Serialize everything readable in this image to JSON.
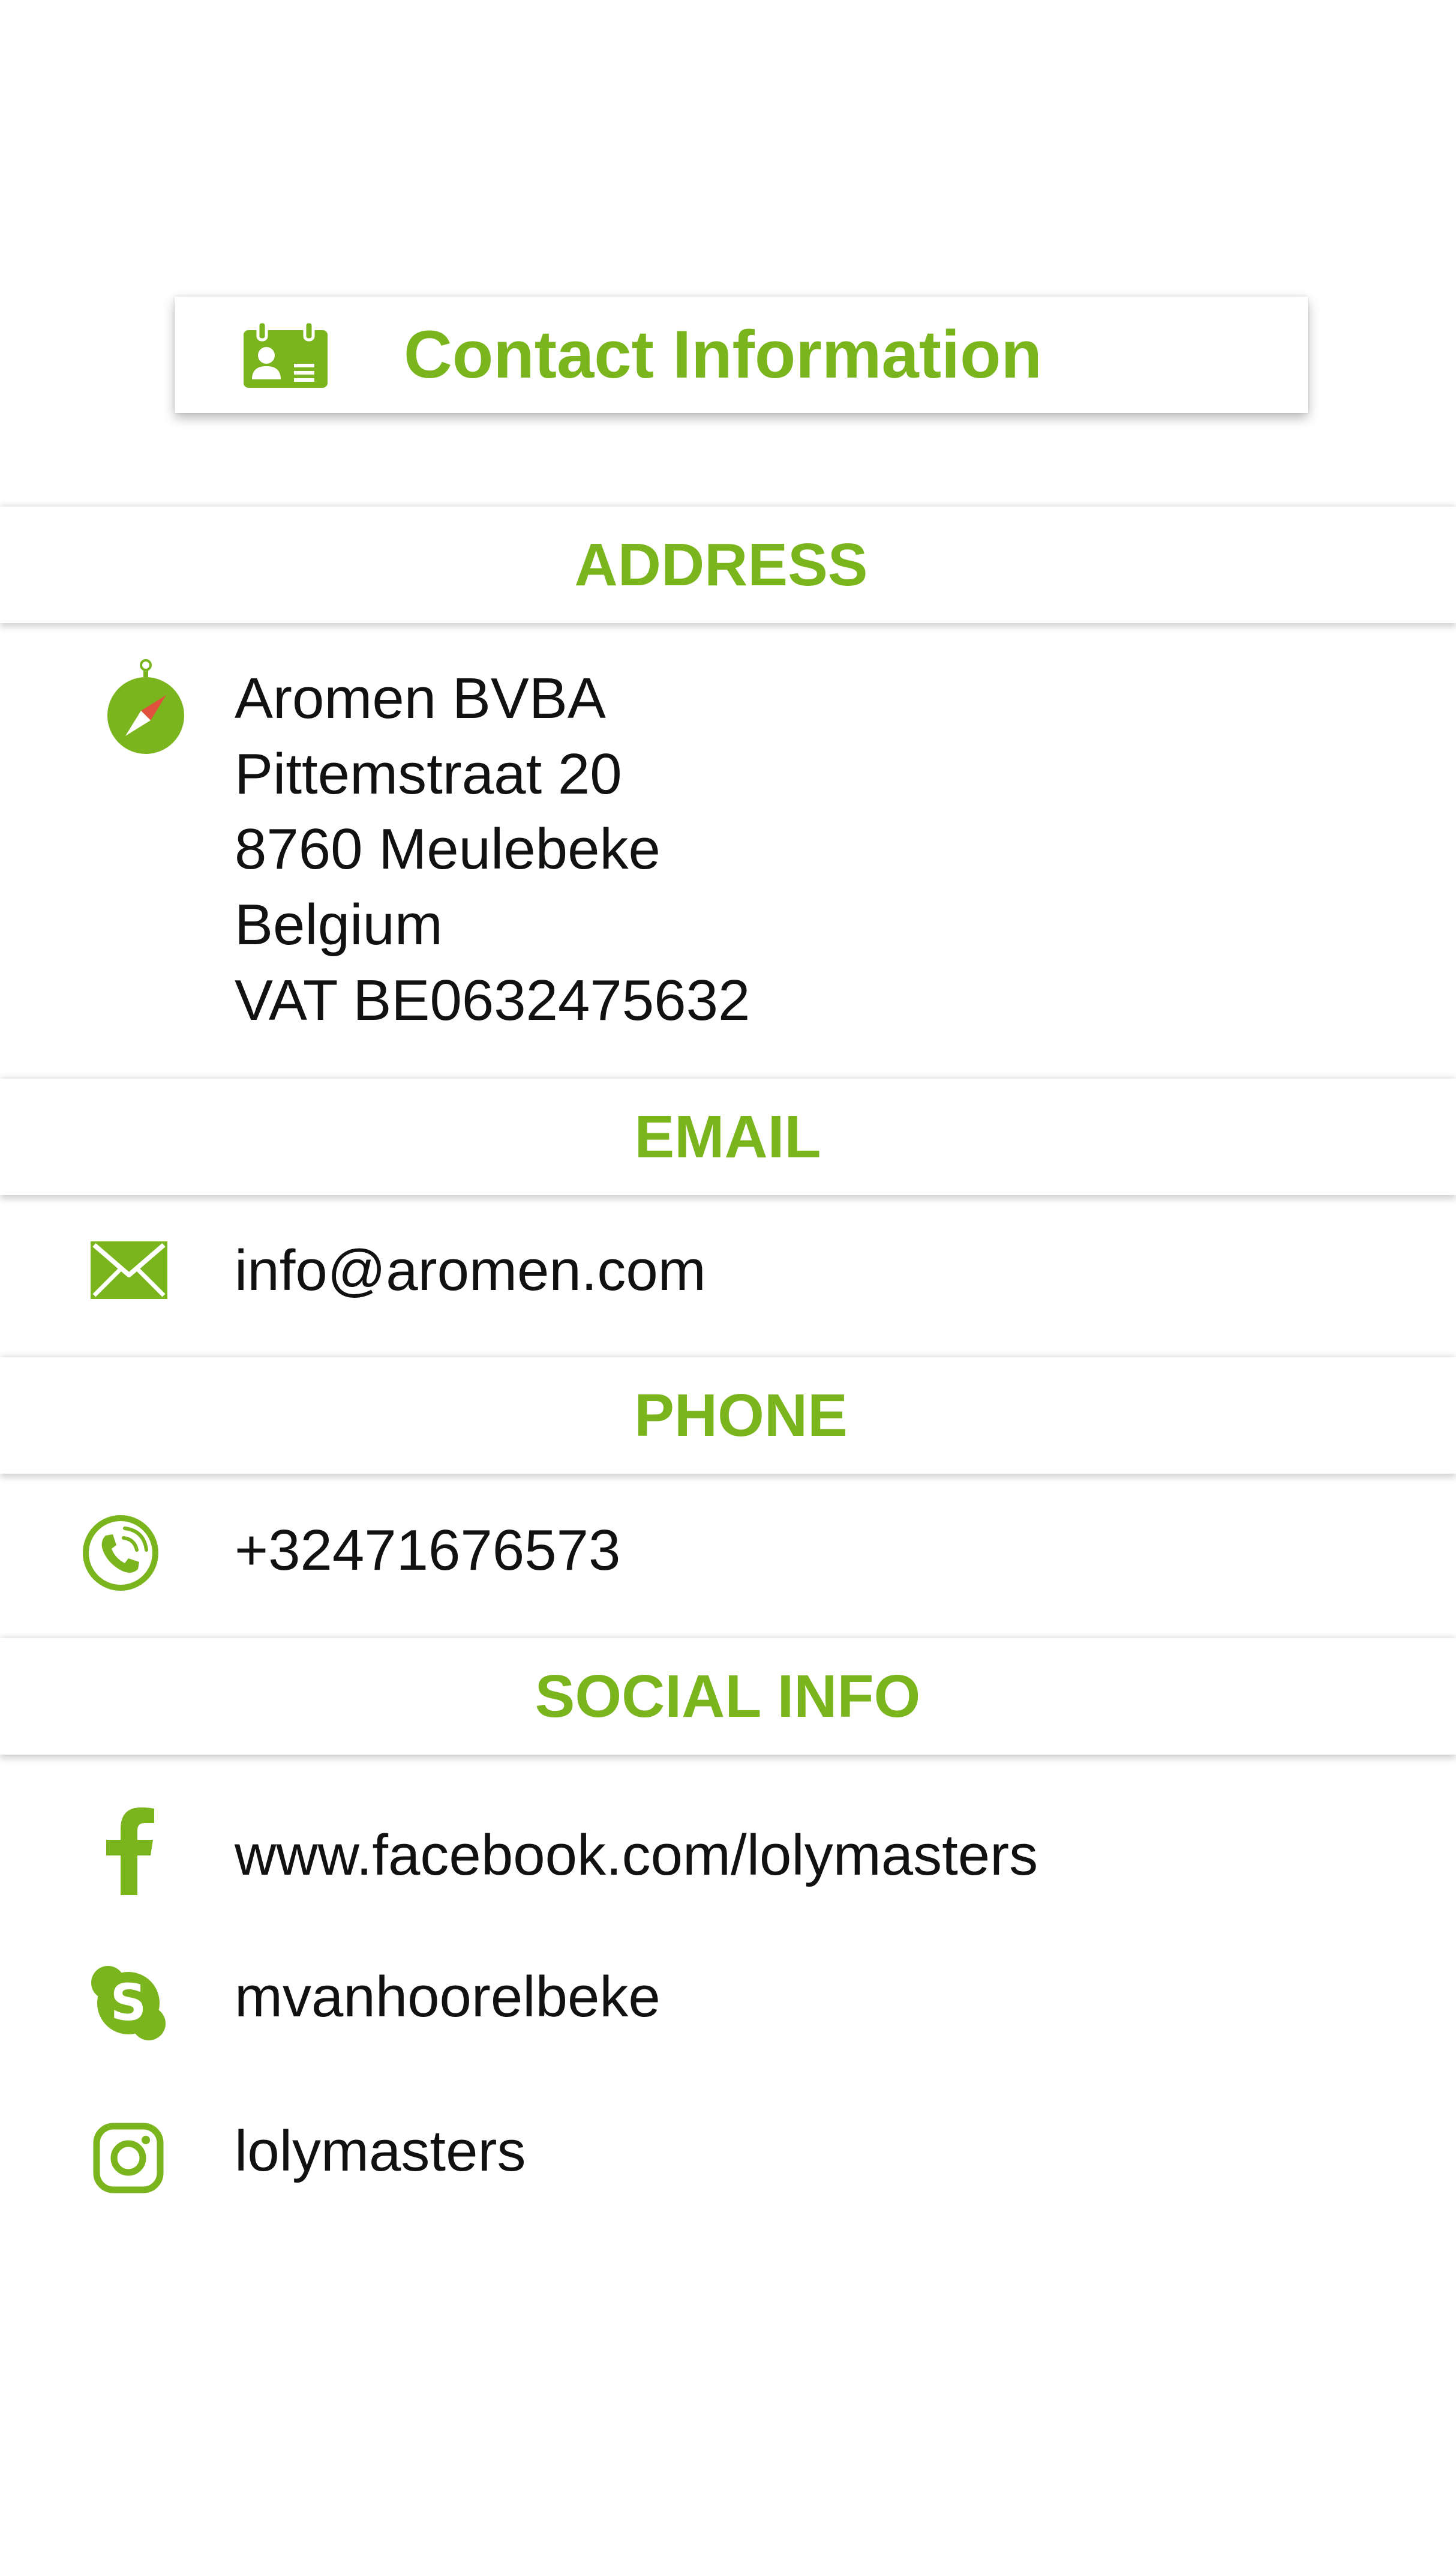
{
  "title": "Contact Information",
  "sections": {
    "address": {
      "header": "ADDRESS",
      "lines": [
        "Aromen BVBA",
        "Pittemstraat 20",
        "8760 Meulebeke",
        "Belgium",
        "VAT BE0632475632"
      ]
    },
    "email": {
      "header": "EMAIL",
      "value": "info@aromen.com"
    },
    "phone": {
      "header": "PHONE",
      "value": "+32471676573"
    },
    "social": {
      "header": "SOCIAL INFO",
      "facebook": "www.facebook.com/lolymasters",
      "skype": "mvanhoorelbeke",
      "instagram": "lolymasters"
    }
  },
  "icons": {
    "title": "contact-card-icon",
    "address": "compass-icon",
    "email": "envelope-icon",
    "phone": "phone-icon",
    "facebook": "facebook-icon",
    "skype": "skype-icon",
    "instagram": "instagram-icon"
  },
  "colors": {
    "accent": "#7ab51d",
    "text": "#111111",
    "compass_needle": "#e0523e"
  }
}
